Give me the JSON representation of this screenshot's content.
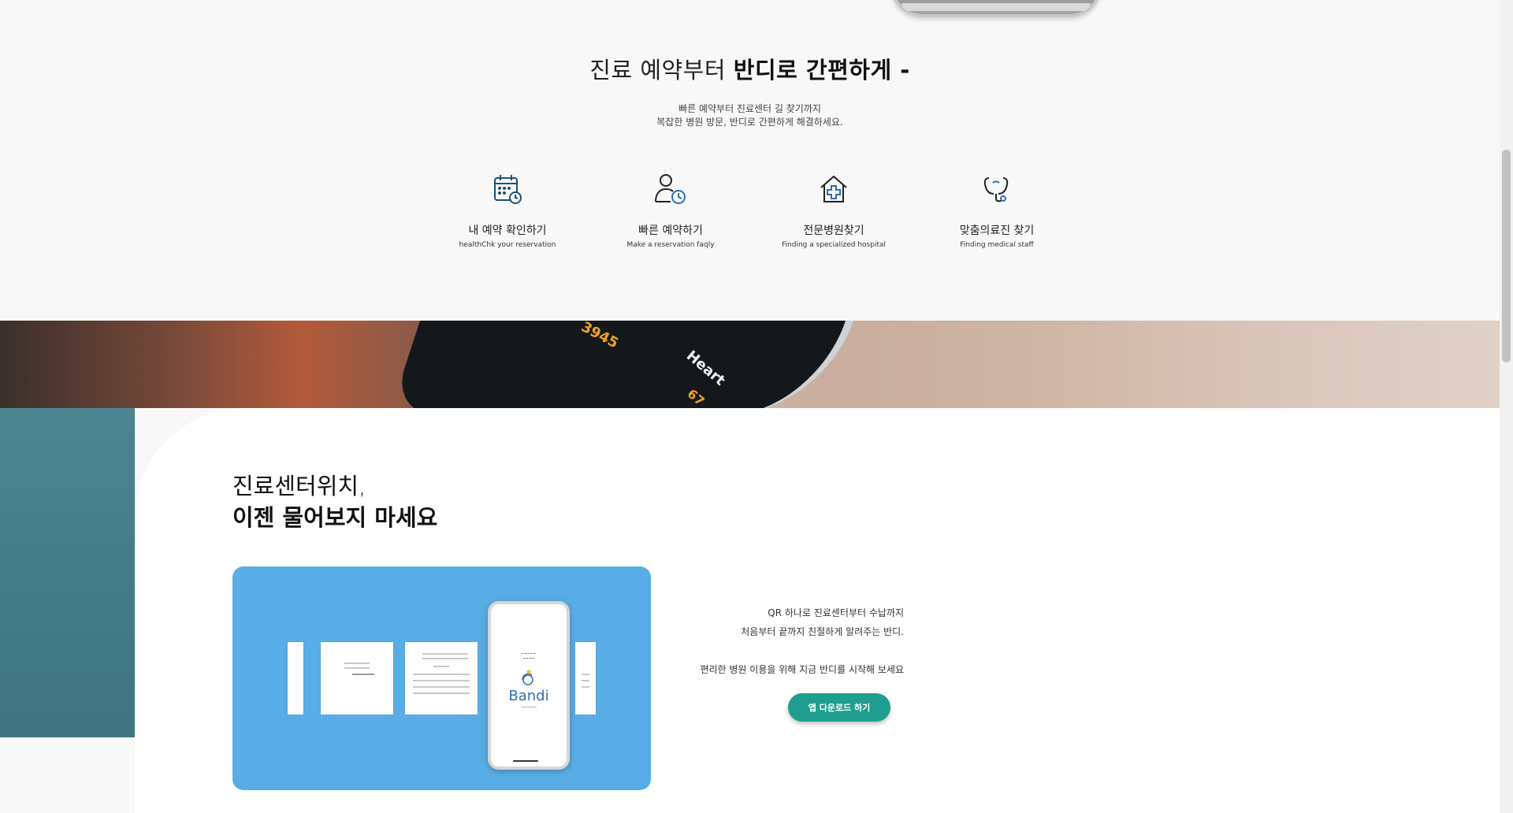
{
  "section_booking": {
    "title_light": "진료 예약부터",
    "title_bold": "반디로 간편하게 -",
    "desc_line1": "빠른 예약부터 진료센터 길 찾기까지",
    "desc_line2": "복잡한 병원 방문, 반디로 간편하게 해결하세요.",
    "features": [
      {
        "icon": "calendar-clock-icon",
        "ko": "내 예약 확인하기",
        "en": "healthChk your reservation"
      },
      {
        "icon": "user-clock-icon",
        "ko": "빠른 예약하기",
        "en": "Make a reservation faqly"
      },
      {
        "icon": "hospital-house-icon",
        "ko": "전문병원찾기",
        "en": "Finding a specialized hospital"
      },
      {
        "icon": "stethoscope-icon",
        "ko": "맞춤의료진 찾기",
        "en": "Finding medical staff"
      }
    ]
  },
  "banner": {
    "watch_steps": "3945",
    "watch_heart_label": "Heart",
    "watch_heart_value": "67"
  },
  "section_location": {
    "title_line1": "진료센터위치,",
    "title_line2": "이젠 물어보지 마세요",
    "text_line1": "QR 하나로 진료센터부터 수납까지",
    "text_line2": "처음부터 끝까지 친절하게 알려주는 반디.",
    "text_line3": "편리한 병원 이용을 위해 지금 반디를 시작해 보세요",
    "download_label": "앱 다운로드 하기",
    "phone_app_name": "Bandi",
    "colors": {
      "accent": "#1f9e8f",
      "mockup_bg": "#58ade6",
      "logo": "#2f6db0"
    }
  }
}
